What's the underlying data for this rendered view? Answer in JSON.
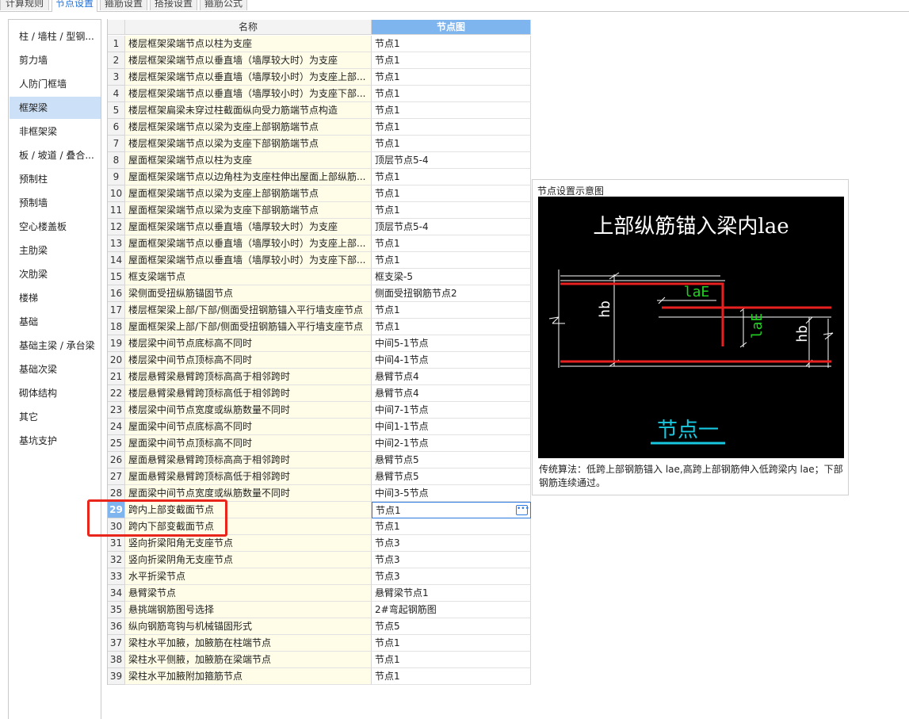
{
  "tabs": [
    "计算规则",
    "节点设置",
    "箍筋设置",
    "搭接设置",
    "箍筋公式"
  ],
  "active_tab": "节点设置",
  "sidebar": {
    "items": [
      "柱 / 墙柱 / 型钢...",
      "剪力墙",
      "人防门框墙",
      "框架梁",
      "非框架梁",
      "板 / 坡道 / 叠合...",
      "预制柱",
      "预制墙",
      "空心楼盖板",
      "主肋梁",
      "次肋梁",
      "楼梯",
      "基础",
      "基础主梁 / 承台梁",
      "基础次梁",
      "砌体结构",
      "其它",
      "基坑支护"
    ],
    "selected": "框架梁"
  },
  "grid": {
    "headers": {
      "name": "名称",
      "node": "节点图"
    },
    "active_row": "29",
    "rows": [
      {
        "no": "1",
        "name": "楼层框架梁端节点以柱为支座",
        "value": "节点1"
      },
      {
        "no": "2",
        "name": "楼层框架梁端节点以垂直墙（墙厚较大时）为支座",
        "value": "节点1"
      },
      {
        "no": "3",
        "name": "楼层框架梁端节点以垂直墙（墙厚较小时）为支座上部...",
        "value": "节点1"
      },
      {
        "no": "4",
        "name": "楼层框架梁端节点以垂直墙（墙厚较小时）为支座下部...",
        "value": "节点1"
      },
      {
        "no": "5",
        "name": "楼层框架扁梁未穿过柱截面纵向受力筋端节点构造",
        "value": "节点1"
      },
      {
        "no": "6",
        "name": "楼层框架梁端节点以梁为支座上部钢筋端节点",
        "value": "节点1"
      },
      {
        "no": "7",
        "name": "楼层框架梁端节点以梁为支座下部钢筋端节点",
        "value": "节点1"
      },
      {
        "no": "8",
        "name": "屋面框架梁端节点以柱为支座",
        "value": "顶层节点5-4"
      },
      {
        "no": "9",
        "name": "屋面框架梁端节点以边角柱为支座柱伸出屋面上部纵筋...",
        "value": "节点1"
      },
      {
        "no": "10",
        "name": "屋面框架梁端节点以梁为支座上部钢筋端节点",
        "value": "节点1"
      },
      {
        "no": "11",
        "name": "屋面框架梁端节点以梁为支座下部钢筋端节点",
        "value": "节点1"
      },
      {
        "no": "12",
        "name": "屋面框架梁端节点以垂直墙（墙厚较大时）为支座",
        "value": "顶层节点5-4"
      },
      {
        "no": "13",
        "name": "屋面框架梁端节点以垂直墙（墙厚较小时）为支座上部...",
        "value": "节点1"
      },
      {
        "no": "14",
        "name": "屋面框架梁端节点以垂直墙（墙厚较小时）为支座下部...",
        "value": "节点1"
      },
      {
        "no": "15",
        "name": "框支梁端节点",
        "value": "框支梁-5"
      },
      {
        "no": "16",
        "name": "梁侧面受扭纵筋锚固节点",
        "value": "侧面受扭钢筋节点2"
      },
      {
        "no": "17",
        "name": "楼层框架梁上部/下部/侧面受扭钢筋锚入平行墙支座节点",
        "value": "节点1"
      },
      {
        "no": "18",
        "name": "屋面框架梁上部/下部/侧面受扭钢筋锚入平行墙支座节点",
        "value": "节点1"
      },
      {
        "no": "19",
        "name": "楼层梁中间节点底标高不同时",
        "value": "中间5-1节点"
      },
      {
        "no": "20",
        "name": "楼层梁中间节点顶标高不同时",
        "value": "中间4-1节点"
      },
      {
        "no": "21",
        "name": "楼层悬臂梁悬臂跨顶标高高于相邻跨时",
        "value": "悬臂节点4"
      },
      {
        "no": "22",
        "name": "楼层悬臂梁悬臂跨顶标高低于相邻跨时",
        "value": "悬臂节点4"
      },
      {
        "no": "23",
        "name": "楼层梁中间节点宽度或纵筋数量不同时",
        "value": "中间7-1节点"
      },
      {
        "no": "24",
        "name": "屋面梁中间节点底标高不同时",
        "value": "中间1-1节点"
      },
      {
        "no": "25",
        "name": "屋面梁中间节点顶标高不同时",
        "value": "中间2-1节点"
      },
      {
        "no": "26",
        "name": "屋面悬臂梁悬臂跨顶标高高于相邻跨时",
        "value": "悬臂节点5"
      },
      {
        "no": "27",
        "name": "屋面悬臂梁悬臂跨顶标高低于相邻跨时",
        "value": "悬臂节点5"
      },
      {
        "no": "28",
        "name": "屋面梁中间节点宽度或纵筋数量不同时",
        "value": "中间3-5节点"
      },
      {
        "no": "29",
        "name": "跨内上部变截面节点",
        "value": "节点1"
      },
      {
        "no": "30",
        "name": "跨内下部变截面节点",
        "value": "节点1"
      },
      {
        "no": "31",
        "name": "竖向折梁阳角无支座节点",
        "value": "节点3"
      },
      {
        "no": "32",
        "name": "竖向折梁阴角无支座节点",
        "value": "节点3"
      },
      {
        "no": "33",
        "name": "水平折梁节点",
        "value": "节点3"
      },
      {
        "no": "34",
        "name": "悬臂梁节点",
        "value": "悬臂梁节点1"
      },
      {
        "no": "35",
        "name": "悬挑端钢筋图号选择",
        "value": "2#弯起钢筋图"
      },
      {
        "no": "36",
        "name": "纵向钢筋弯钩与机械锚固形式",
        "value": "节点5"
      },
      {
        "no": "37",
        "name": "梁柱水平加腋，加腋筋在柱端节点",
        "value": "节点1"
      },
      {
        "no": "38",
        "name": "梁柱水平侧腋，加腋筋在梁端节点",
        "value": "节点1"
      },
      {
        "no": "39",
        "name": "梁柱水平加腋附加箍筋节点",
        "value": "节点1"
      }
    ]
  },
  "preview": {
    "title": "节点设置示意图",
    "diagram": {
      "heading": "上部纵筋锚入梁内lae",
      "label_lae_horizontal": "laE",
      "label_lae_vertical": "laE",
      "label_hb_left": "hb",
      "label_hb_right": "hb",
      "caption": "节点一",
      "colors": {
        "background": "#000000",
        "rebar": "#e82020",
        "dim_green": "#22d022",
        "caption": "#18c8e0",
        "text": "#ffffff"
      }
    },
    "description": "传统算法：低跨上部钢筋锚入 lae,高跨上部钢筋伸入低跨梁内 lae；下部钢筋连续通过。"
  },
  "colors": {
    "selection_blue": "#7fb5ef",
    "sidebar_selected": "#cce0f7",
    "name_cell_bg": "#fffde7",
    "highlight_red": "#e8261c"
  }
}
